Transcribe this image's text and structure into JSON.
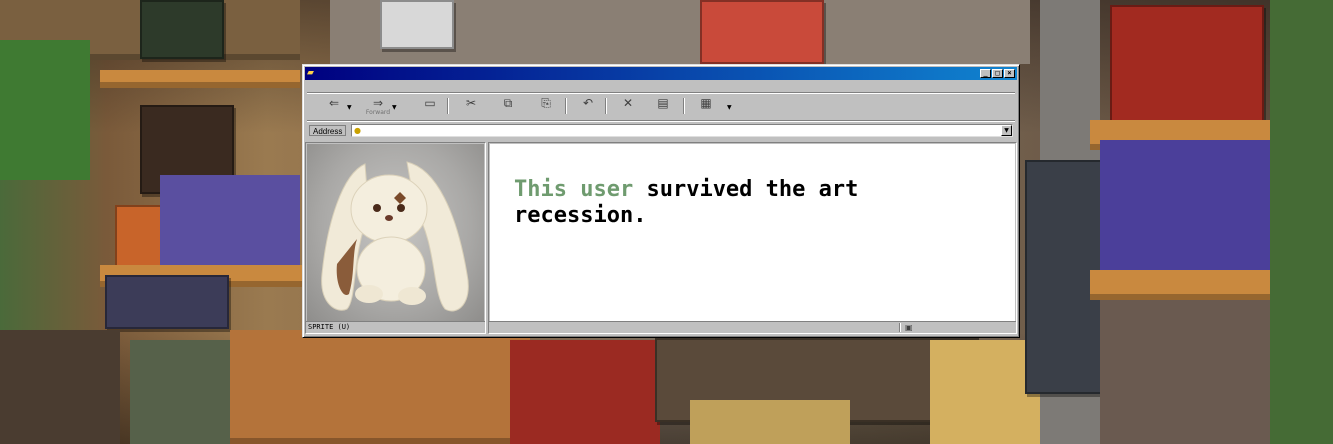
{
  "window": {
    "icon": "folder-icon",
    "controls": {
      "minimize": "_",
      "maximize": "□",
      "close": "×"
    }
  },
  "toolbar": {
    "back_icon": "back-arrow-icon",
    "forward_label": "Forward",
    "icons": [
      "back-arrow-icon",
      "forward-arrow-icon",
      "up-folder-icon",
      "cut-icon",
      "copy-icon",
      "paste-icon",
      "undo-icon",
      "delete-icon",
      "properties-icon",
      "views-icon"
    ]
  },
  "address": {
    "label": "Address",
    "value": ""
  },
  "left_pane": {
    "image": "plush-bunny-photo",
    "status": "SPRITE (U)"
  },
  "main": {
    "message_highlight": "This user",
    "message_rest": " survived the art recession."
  },
  "colors": {
    "title_start": "#000080",
    "title_end": "#1084d0",
    "highlight_text": "#6f9b6f",
    "window_face": "#c0c0c0"
  }
}
